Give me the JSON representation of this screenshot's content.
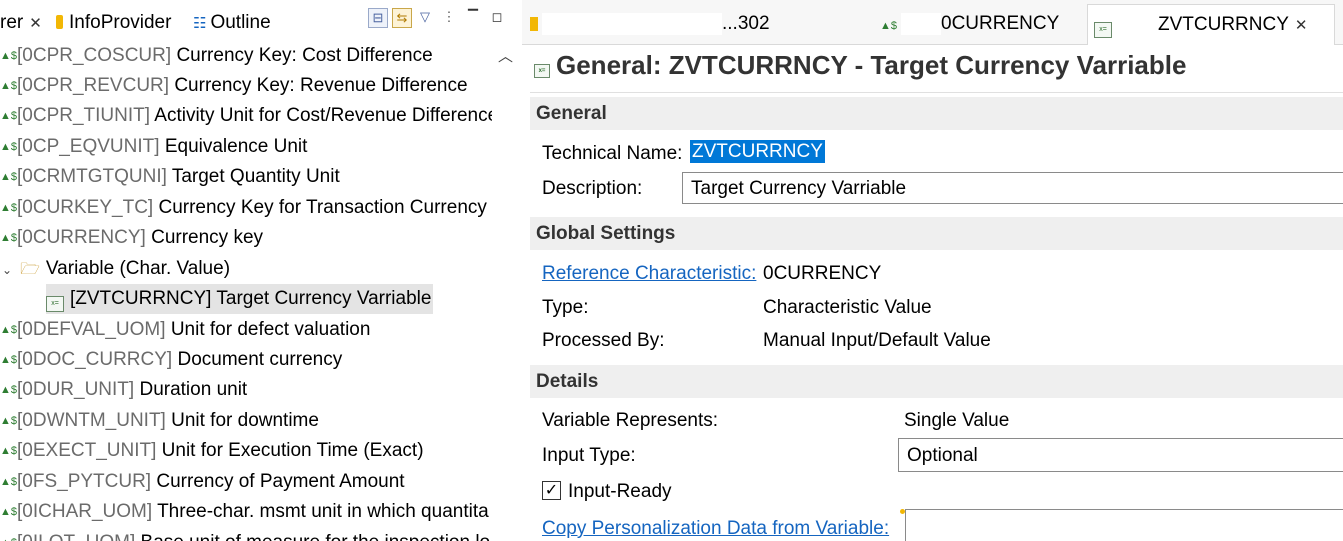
{
  "left_tabs": {
    "first_tab_fragment": "rer",
    "infoprovider_label": "InfoProvider",
    "outline_label": "Outline"
  },
  "tree": {
    "items": [
      {
        "tech": "[0CPR_COSCUR]",
        "text": "Currency Key: Cost Difference"
      },
      {
        "tech": "[0CPR_REVCUR]",
        "text": "Currency Key: Revenue Difference"
      },
      {
        "tech": "[0CPR_TIUNIT]",
        "text": "Activity Unit for Cost/Revenue Difference"
      },
      {
        "tech": "[0CP_EQVUNIT]",
        "text": "Equivalence Unit"
      },
      {
        "tech": "[0CRMTGTQUNI]",
        "text": "Target Quantity Unit"
      },
      {
        "tech": "[0CURKEY_TC]",
        "text": "Currency Key for Transaction Currency"
      },
      {
        "tech": "[0CURRENCY]",
        "text": "Currency key"
      }
    ],
    "folder_label": "Variable (Char. Value)",
    "selected_item": "[ZVTCURRNCY] Target Currency Varriable",
    "items_after": [
      {
        "tech": "[0DEFVAL_UOM]",
        "text": "Unit for defect valuation"
      },
      {
        "tech": "[0DOC_CURRCY]",
        "text": "Document currency"
      },
      {
        "tech": "[0DUR_UNIT]",
        "text": "Duration unit"
      },
      {
        "tech": "[0DWNTM_UNIT]",
        "text": "Unit for downtime"
      },
      {
        "tech": "[0EXECT_UNIT]",
        "text": "Unit for Execution Time (Exact)"
      },
      {
        "tech": "[0FS_PYTCUR]",
        "text": "Currency of Payment Amount"
      },
      {
        "tech": "[0ICHAR_UOM]",
        "text": "Three-char. msmt unit in which quantita"
      },
      {
        "tech": "[0ILOT_UOM]",
        "text": "Base unit of measure for the inspection lo"
      }
    ]
  },
  "editor_tabs": [
    {
      "label": "...302"
    },
    {
      "label": "0CURRENCY"
    },
    {
      "label": "ZVTCURRNCY",
      "active": true
    }
  ],
  "form": {
    "title": "General: ZVTCURRNCY - Target Currency Varriable",
    "general_section": "General",
    "technical_name_label": "Technical Name:",
    "technical_name_value": "ZVTCURRNCY",
    "description_label": "Description:",
    "description_value": "Target Currency Varriable",
    "global_section": "Global Settings",
    "reference_char_label": "Reference Characteristic:",
    "reference_char_value": "0CURRENCY",
    "type_label": "Type:",
    "type_value": "Characteristic Value",
    "processed_by_label": "Processed By:",
    "processed_by_value": "Manual Input/Default Value",
    "details_section": "Details",
    "var_represents_label": "Variable Represents:",
    "var_represents_value": "Single Value",
    "input_type_label": "Input Type:",
    "input_type_value": "Optional",
    "input_ready_label": "Input-Ready",
    "input_ready_checked": true,
    "copy_personalization_label": "Copy Personalization Data from Variable:",
    "copy_personalization_value": ""
  },
  "colors": {
    "link": "#1565c0",
    "selection": "#0078d7",
    "section_bg": "#efefef"
  }
}
